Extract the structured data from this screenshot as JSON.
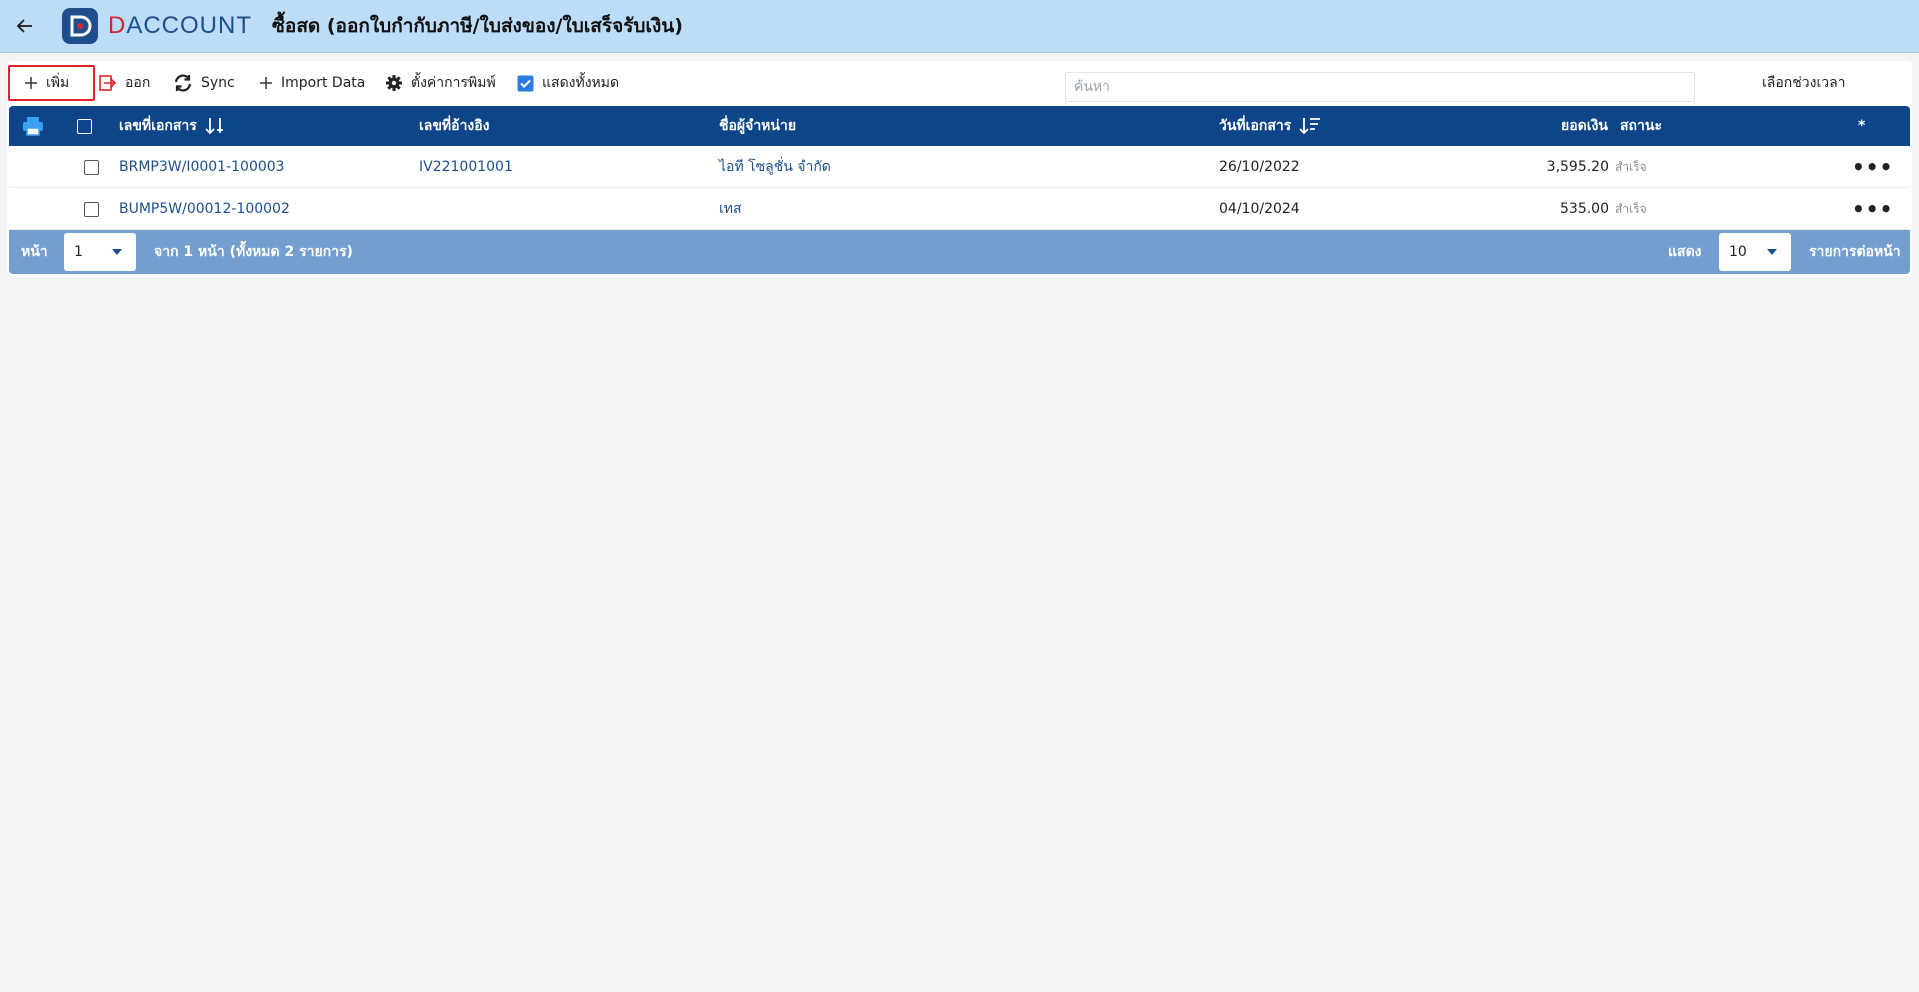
{
  "header": {
    "back_icon": "arrow-left-icon",
    "logo_text_d": "D",
    "logo_text_rest": "ACCOUNT",
    "title": "ซื้อสด (ออกใบกำกับภาษี/ใบส่งของ/ใบเสร็จรับเงิน)"
  },
  "toolbar": {
    "add_label": "เพิ่ม",
    "exit_label": "ออก",
    "sync_label": "Sync",
    "import_label": "Import Data",
    "print_settings_label": "ตั้งค่าการพิมพ์",
    "show_all_label": "แสดงทั้งหมด",
    "show_all_checked": true,
    "search_placeholder": "ค้นหา",
    "period_label": "เลือกช่วงเวลา"
  },
  "table": {
    "columns": {
      "doc_no": "เลขที่เอกสาร",
      "ref_no": "เลขที่อ้างอิง",
      "vendor": "ชื่อผู้จำหน่าย",
      "doc_date": "วันที่เอกสาร",
      "amount": "ยอดเงิน",
      "status": "สถานะ",
      "action": "*"
    },
    "rows": [
      {
        "doc_no": "BRMP3W/I0001-100003",
        "ref_no": "IV221001001",
        "vendor": "ไอที โซลูชั่น จำกัด",
        "doc_date": "26/10/2022",
        "amount": "3,595.20",
        "status": "สำเร็จ",
        "more": "•••"
      },
      {
        "doc_no": "BUMP5W/00012-100002",
        "ref_no": "",
        "vendor": "เทส",
        "doc_date": "04/10/2024",
        "amount": "535.00",
        "status": "สำเร็จ",
        "more": "•••"
      }
    ]
  },
  "pager": {
    "page_label": "หน้า",
    "page_value": "1",
    "of_pages": "จาก 1 หน้า (ทั้งหมด 2 รายการ)",
    "show_label": "แสดง",
    "per_page_value": "10",
    "per_page_label": "รายการต่อหน้า"
  },
  "colors": {
    "header_bg": "#bcdcf7",
    "table_head": "#0d4588",
    "pager_bg": "#739ece",
    "link": "#1d4f8e",
    "highlight": "#e0232a"
  }
}
